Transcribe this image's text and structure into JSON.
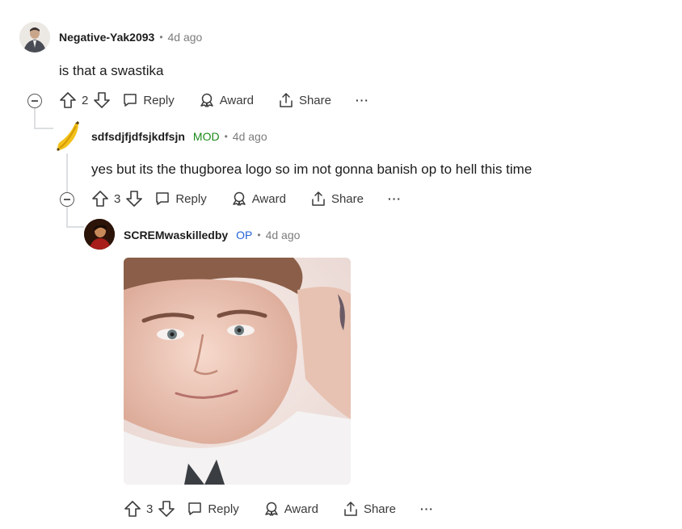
{
  "comments": [
    {
      "username": "Negative-Yak2093",
      "flair": "",
      "time": "4d ago",
      "body": "is that a swastika",
      "score": "2",
      "reply_label": "Reply",
      "award_label": "Award",
      "share_label": "Share",
      "more_label": "···"
    },
    {
      "username": "sdfsdjfjdfsjkdfsjn",
      "flair": "MOD",
      "time": "4d ago",
      "body": "yes but its the thugborea logo so im not gonna banish op to hell this time",
      "score": "3",
      "reply_label": "Reply",
      "award_label": "Award",
      "share_label": "Share",
      "more_label": "···"
    },
    {
      "username": "SCREMwaskilledby",
      "flair": "OP",
      "time": "4d ago",
      "body": "",
      "score": "3",
      "reply_label": "Reply",
      "award_label": "Award",
      "share_label": "Share",
      "more_label": "···"
    }
  ],
  "separator": "•",
  "colors": {
    "mod_flair": "#1a8a1a",
    "op_flair": "#2562d8",
    "thread_line": "#dcdfe2"
  },
  "icons": [
    "upvote-icon",
    "downvote-icon",
    "comment-icon",
    "award-icon",
    "share-icon",
    "collapse-icon"
  ]
}
